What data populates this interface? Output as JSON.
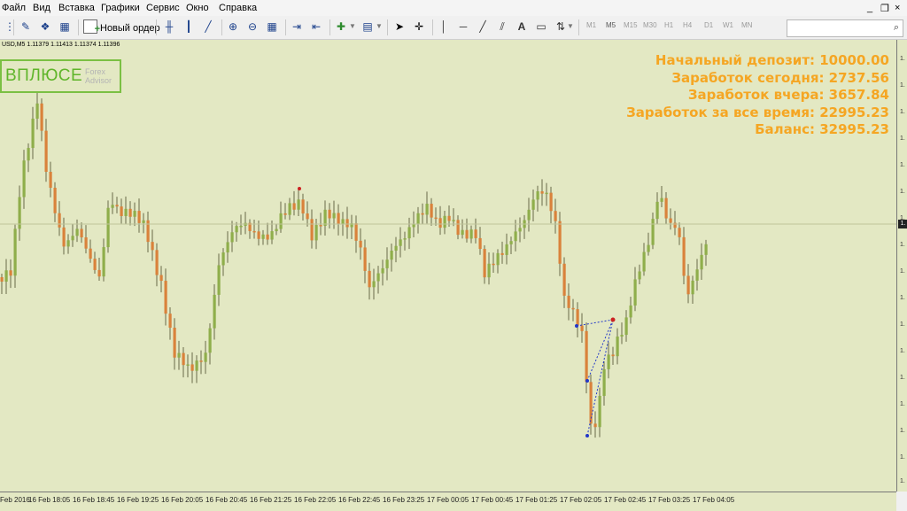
{
  "menu": {
    "items": [
      "Файл",
      "Вид",
      "Вставка",
      "Графики",
      "Сервис",
      "Окно",
      "Справка"
    ]
  },
  "window_controls": {
    "minimize": "_",
    "restore": "❐",
    "close": "×"
  },
  "toolbar": {
    "new_order_label": "Новый ордер",
    "timeframes": [
      "M1",
      "M5",
      "M15",
      "M30",
      "H1",
      "H4",
      "D1",
      "W1",
      "MN"
    ],
    "active_timeframe": "M5",
    "search_value": ""
  },
  "chart": {
    "symbol_line": "USD,M5  1.11379 1.11413 1.11374 1.11396",
    "logo": {
      "main": "ВПЛЮСЕ",
      "sub_line1": "Forex",
      "sub_line2": "Advisor"
    },
    "stats": [
      "Начальный депозит: 10000.00",
      "Заработок сегодня: 2737.56",
      "Заработок вчера: 3657.84",
      "Заработок за все время: 22995.23",
      "Баланс: 32995.23"
    ],
    "price_scale_ticks": [
      "1.",
      "1.",
      "1.",
      "1.",
      "1.",
      "1.",
      "1.",
      "1.",
      "1.",
      "1.",
      "1.",
      "1.",
      "1.",
      "1.",
      "1.",
      "1.",
      "1."
    ],
    "current_price_label": "1.",
    "time_labels": [
      "Feb 2016",
      "16 Feb 18:05",
      "16 Feb 18:45",
      "16 Feb 19:25",
      "16 Feb 20:05",
      "16 Feb 20:45",
      "16 Feb 21:25",
      "16 Feb 22:05",
      "16 Feb 22:45",
      "16 Feb 23:25",
      "17 Feb 00:05",
      "17 Feb 00:45",
      "17 Feb 01:25",
      "17 Feb 02:05",
      "17 Feb 02:45",
      "17 Feb 03:25",
      "17 Feb 04:05"
    ],
    "colors": {
      "bull": "#8fae4b",
      "bear": "#d9823b",
      "wick": "#4a4a2a",
      "background": "#e3e8c3",
      "stats_text": "#f5a623",
      "logo_green": "#5fb52a",
      "trade_line": "#2238c8",
      "trade_exit": "#cc2222"
    }
  }
}
